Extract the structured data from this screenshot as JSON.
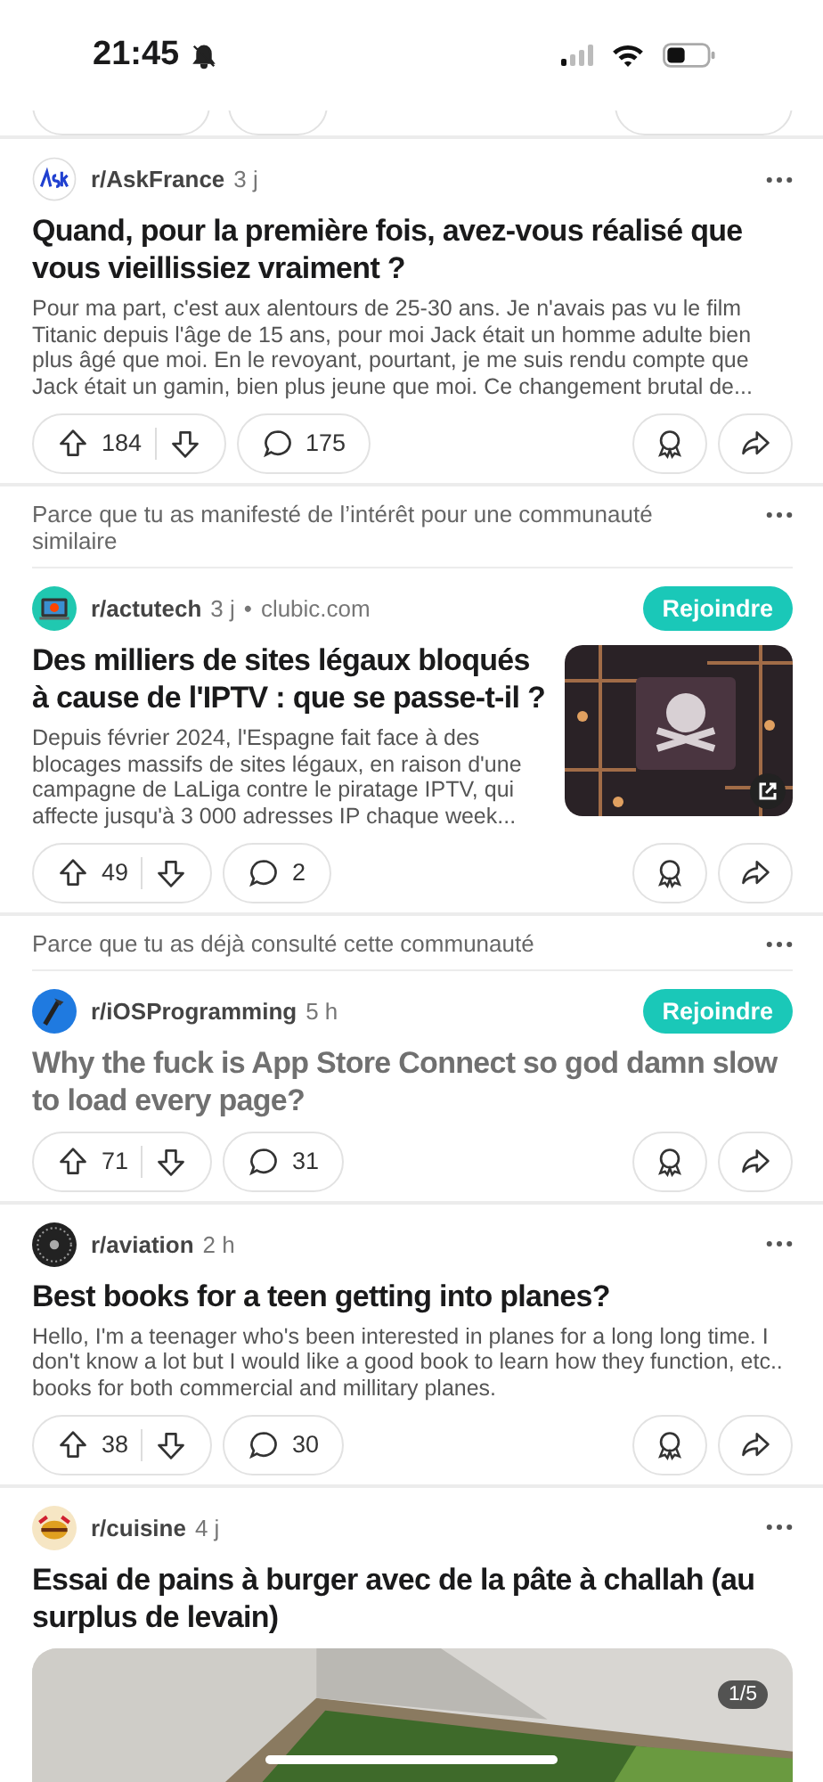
{
  "status_bar": {
    "time": "21:45"
  },
  "posts": [
    {
      "kind": "text",
      "subreddit": "r/AskFrance",
      "age": "3 j",
      "title": "Quand, pour la première fois, avez-vous réalisé que vous vieillissiez vraiment ?",
      "visited": false,
      "body": "Pour ma part, c'est aux alentours de 25-30 ans. Je n'avais pas vu le film Titanic depuis l'âge de 15 ans, pour moi Jack était un homme adulte bien plus âgé que moi. En le revoyant, pourtant, je me suis rendu compte que Jack était un gamin, bien plus jeune que moi. Ce changement brutal de...",
      "votes": "184",
      "comments": "175"
    },
    {
      "kind": "link",
      "reason": "Parce que tu as manifesté de l’intérêt pour une communauté similaire",
      "subreddit": "r/actutech",
      "age": "3 j",
      "dot": "•",
      "domain": "clubic.com",
      "join": "Rejoindre",
      "title": "Des milliers de sites légaux bloqués à cause de l'IPTV : que se passe-t-il ?",
      "visited": false,
      "body": "Depuis février 2024, l'Espagne fait face à des blocages massifs de sites légaux, en raison d'une campagne de LaLiga contre le piratage IPTV, qui affecte jusqu'à 3 000 adresses IP chaque week...",
      "votes": "49",
      "comments": "2"
    },
    {
      "kind": "text",
      "reason": "Parce que tu as déjà consulté cette communauté",
      "subreddit": "r/iOSProgramming",
      "age": "5 h",
      "join": "Rejoindre",
      "title": "Why the fuck is App Store Connect so god damn slow to load every page?",
      "visited": true,
      "votes": "71",
      "comments": "31"
    },
    {
      "kind": "text",
      "subreddit": "r/aviation",
      "age": "2 h",
      "title": "Best books for a teen getting into planes?",
      "visited": false,
      "body": "Hello, I'm a teenager who's been interested in planes for a long long time. I don't know a lot but I would like a good book to learn how they function, etc.. books for both commercial and millitary planes.",
      "votes": "38",
      "comments": "30"
    },
    {
      "kind": "gallery",
      "subreddit": "r/cuisine",
      "age": "4 j",
      "title": "Essai de pains à burger avec de la pâte à challah (au surplus de levain)",
      "visited": false,
      "gallery_counter": "1/5"
    }
  ]
}
